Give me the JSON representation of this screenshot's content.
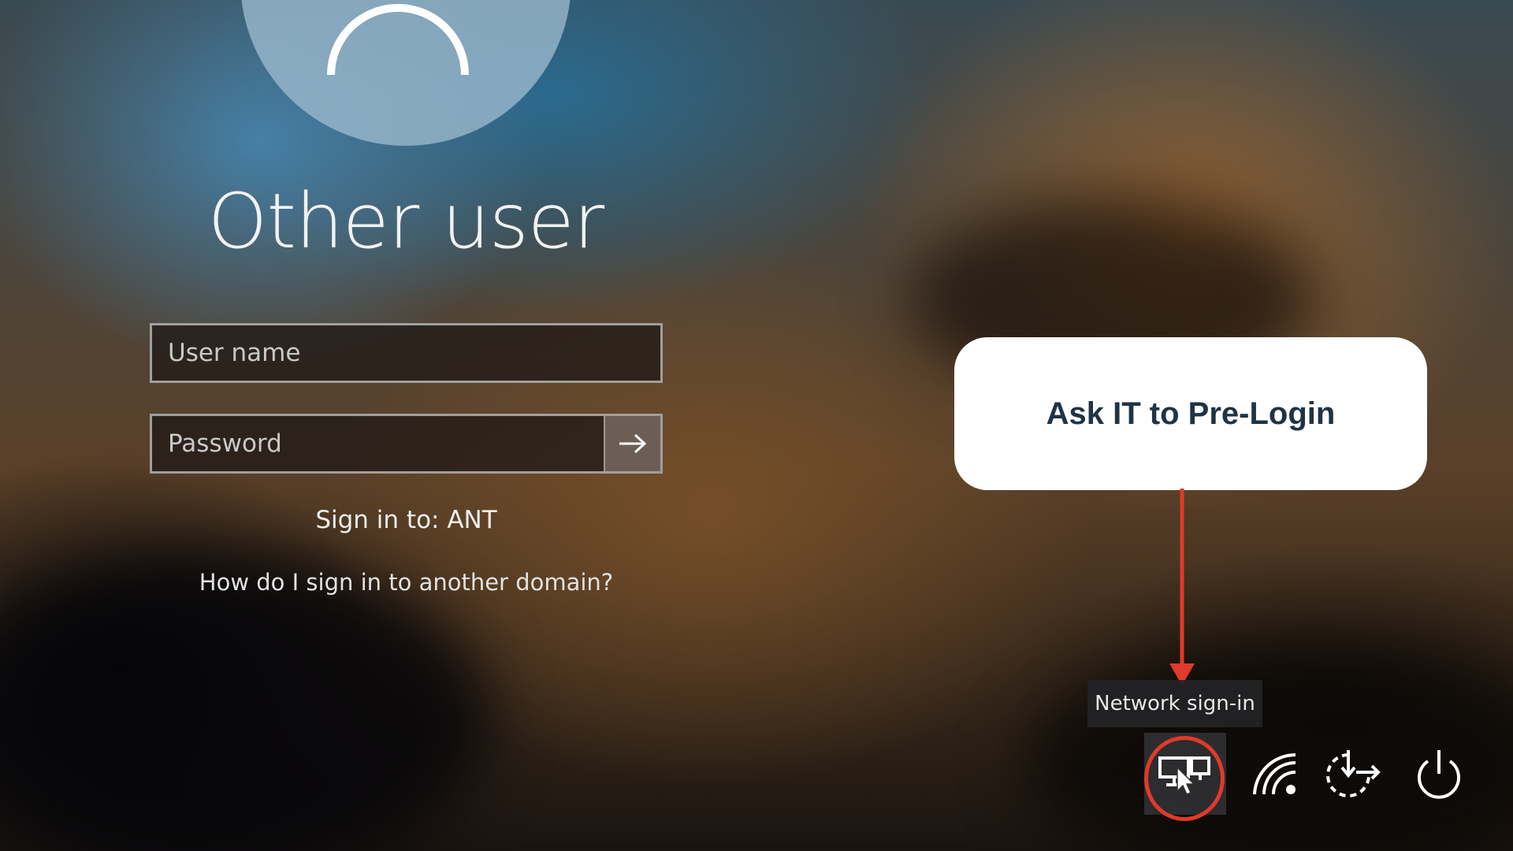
{
  "login": {
    "user_title": "Other user",
    "username_placeholder": "User name",
    "password_placeholder": "Password",
    "signin_to": "Sign in to: ANT",
    "other_domain_link": "How do I sign in to another domain?"
  },
  "annotation": {
    "callout_text": "Ask IT to Pre-Login",
    "arrow_color": "#e03a2a",
    "highlight_color": "#e03a2a"
  },
  "tray": {
    "tooltip": "Network sign-in",
    "icons": [
      "network-signin-icon",
      "wifi-icon",
      "accessibility-icon",
      "power-icon"
    ]
  }
}
